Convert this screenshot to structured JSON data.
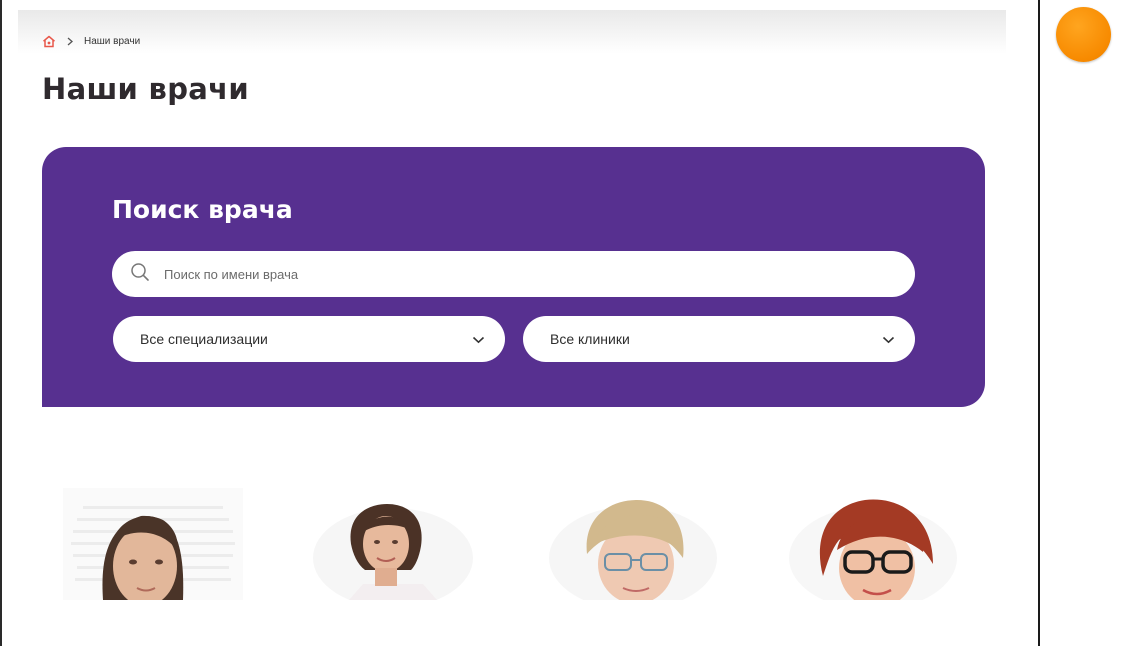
{
  "breadcrumb": {
    "home_icon": "home-icon",
    "separator_icon": "chevron-right-icon",
    "current": "Наши врачи"
  },
  "page": {
    "title": "Наши врачи"
  },
  "search": {
    "title": "Поиск врача",
    "name_placeholder": "Поиск по имени врача",
    "specialization_value": "Все специализации",
    "clinic_value": "Все клиники"
  },
  "doctors": [
    {
      "photo": "doctor-photo-1"
    },
    {
      "photo": "doctor-photo-2"
    },
    {
      "photo": "doctor-photo-3"
    },
    {
      "photo": "doctor-photo-4"
    }
  ],
  "colors": {
    "panel": "#573090",
    "accent": "#f78a00",
    "title_text": "#2f2a2e",
    "home_icon": "#e8574a"
  }
}
